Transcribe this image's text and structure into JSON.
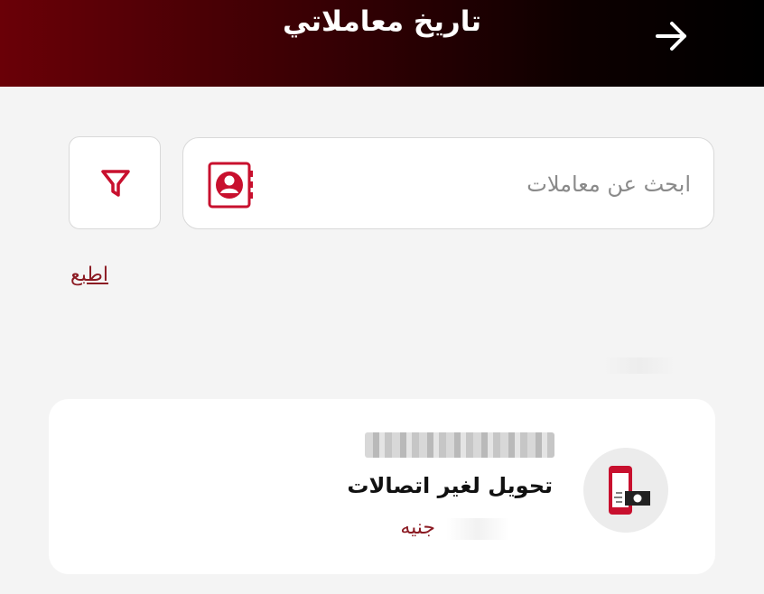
{
  "header": {
    "title": "تاريخ معاملاتي",
    "back_icon": "arrow-right-icon",
    "gradient_colors": [
      "#6a0007",
      "#000000"
    ]
  },
  "search": {
    "placeholder": "ابحث عن معاملات",
    "value": "",
    "contacts_icon": "contacts-book-icon",
    "filter_icon": "filter-funnel-icon"
  },
  "actions": {
    "print_label": "اطبع"
  },
  "transactions": [
    {
      "number_masked": true,
      "title": "تحويل لغير اتصالات",
      "amount_label": "جنيه",
      "icon": "phone-money-transfer-icon"
    }
  ],
  "colors": {
    "accent": "#c8102e",
    "accent_dark": "#8b1a22",
    "background": "#f4f4f4",
    "card": "#ffffff"
  }
}
